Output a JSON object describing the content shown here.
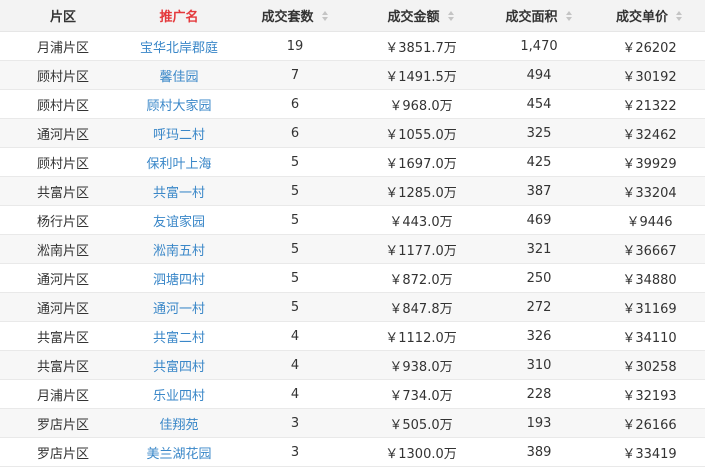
{
  "headers": [
    {
      "label": "片区",
      "sortable": false
    },
    {
      "label": "推广名",
      "sortable": false
    },
    {
      "label": "成交套数",
      "sortable": true
    },
    {
      "label": "成交金额",
      "sortable": true
    },
    {
      "label": "成交面积",
      "sortable": true
    },
    {
      "label": "成交单价",
      "sortable": true
    }
  ],
  "active_header_color": "#e4393c",
  "link_color": "#3a87c8",
  "rows": [
    [
      "月浦片区",
      "宝华北岸郡庭",
      "19",
      "￥3851.7万",
      "1,470",
      "￥26202"
    ],
    [
      "顾村片区",
      "馨佳园",
      "7",
      "￥1491.5万",
      "494",
      "￥30192"
    ],
    [
      "顾村片区",
      "顾村大家园",
      "6",
      "￥968.0万",
      "454",
      "￥21322"
    ],
    [
      "通河片区",
      "呼玛二村",
      "6",
      "￥1055.0万",
      "325",
      "￥32462"
    ],
    [
      "顾村片区",
      "保利叶上海",
      "5",
      "￥1697.0万",
      "425",
      "￥39929"
    ],
    [
      "共富片区",
      "共富一村",
      "5",
      "￥1285.0万",
      "387",
      "￥33204"
    ],
    [
      "杨行片区",
      "友谊家园",
      "5",
      "￥443.0万",
      "469",
      "￥9446"
    ],
    [
      "淞南片区",
      "淞南五村",
      "5",
      "￥1177.0万",
      "321",
      "￥36667"
    ],
    [
      "通河片区",
      "泗塘四村",
      "5",
      "￥872.0万",
      "250",
      "￥34880"
    ],
    [
      "通河片区",
      "通河一村",
      "5",
      "￥847.8万",
      "272",
      "￥31169"
    ],
    [
      "共富片区",
      "共富二村",
      "4",
      "￥1112.0万",
      "326",
      "￥34110"
    ],
    [
      "共富片区",
      "共富四村",
      "4",
      "￥938.0万",
      "310",
      "￥30258"
    ],
    [
      "月浦片区",
      "乐业四村",
      "4",
      "￥734.0万",
      "228",
      "￥32193"
    ],
    [
      "罗店片区",
      "佳翔苑",
      "3",
      "￥505.0万",
      "193",
      "￥26166"
    ],
    [
      "罗店片区",
      "美兰湖花园",
      "3",
      "￥1300.0万",
      "389",
      "￥33419"
    ]
  ]
}
